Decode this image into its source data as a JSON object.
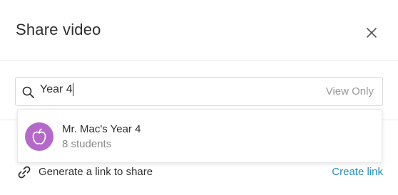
{
  "dialog": {
    "title": "Share video",
    "close_icon": "close-icon"
  },
  "search": {
    "value": "Year 4",
    "permission_label": "View Only",
    "icon": "search-icon"
  },
  "results": [
    {
      "name": "Mr. Mac's Year 4",
      "subtitle": "8 students",
      "icon": "apple-icon"
    }
  ],
  "share_link": {
    "label": "Generate a link to share",
    "action_label": "Create link",
    "icon": "link-icon"
  },
  "colors": {
    "accent": "#2a8fbd",
    "avatar_bg": "#b468c9",
    "muted_text": "#9a9a9a"
  }
}
